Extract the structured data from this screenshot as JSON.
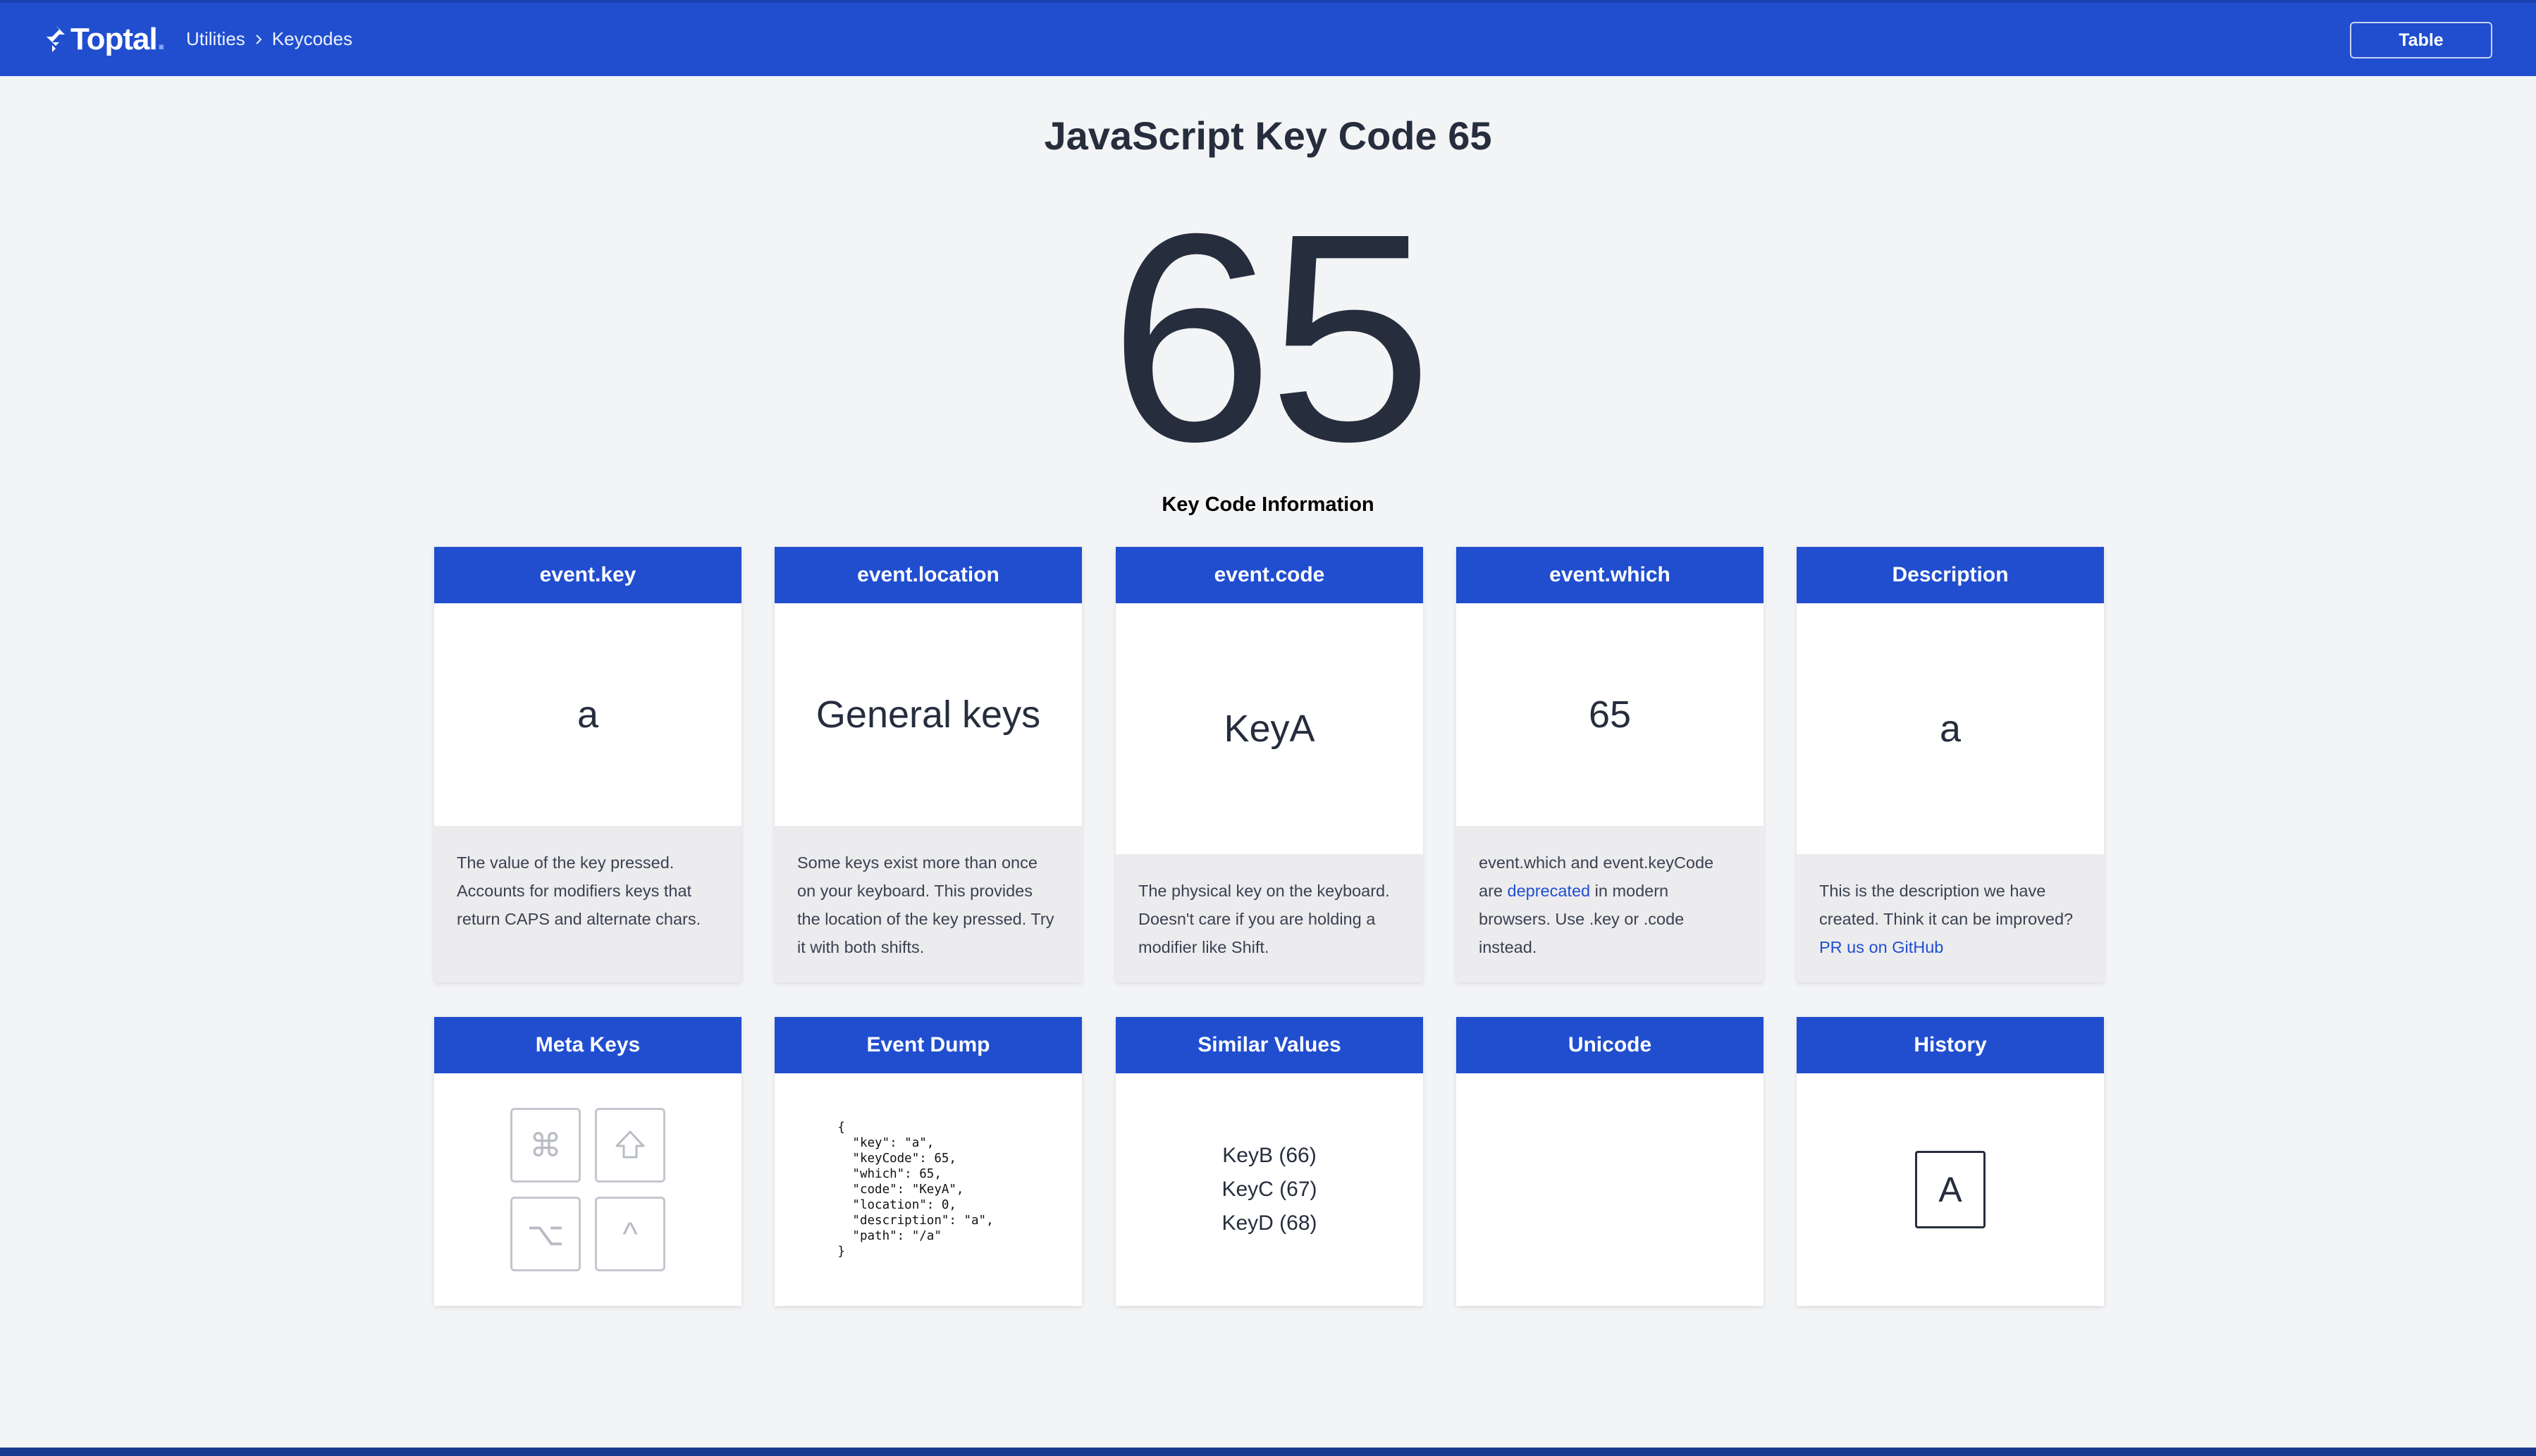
{
  "header": {
    "logo_text": "Toptal",
    "logo_dot": ".",
    "breadcrumb": [
      "Utilities",
      "Keycodes"
    ],
    "table_button": "Table"
  },
  "hero": {
    "title": "JavaScript Key Code 65",
    "code": "65",
    "section_label": "Key Code Information"
  },
  "cards": {
    "event_key": {
      "title": "event.key",
      "value": "a",
      "description": "The value of the key pressed. Accounts for modifiers keys that return CAPS and alternate chars."
    },
    "event_location": {
      "title": "event.location",
      "value": "General keys",
      "description": "Some keys exist more than once on your keyboard. This provides the location of the key pressed. Try it with both shifts."
    },
    "event_code": {
      "title": "event.code",
      "value": "KeyA",
      "description": "The physical key on the keyboard. Doesn't care if you are holding a modifier like Shift."
    },
    "event_which": {
      "title": "event.which",
      "value": "65",
      "description_pre": "event.which and event.keyCode are ",
      "description_link": "deprecated",
      "description_post": " in modern browsers. Use .key or .code instead."
    },
    "description": {
      "title": "Description",
      "value": "a",
      "description_pre": "This is the description we have created. Think it can be improved? ",
      "description_link": "PR us on GitHub"
    },
    "meta_keys": {
      "title": "Meta Keys",
      "keys": [
        {
          "name": "command",
          "glyph": "⌘"
        },
        {
          "name": "shift",
          "glyph": "shift-icon"
        },
        {
          "name": "option",
          "glyph": "⌥"
        },
        {
          "name": "control",
          "glyph": "^"
        }
      ]
    },
    "event_dump": {
      "title": "Event Dump",
      "json": "{\n  \"key\": \"a\",\n  \"keyCode\": 65,\n  \"which\": 65,\n  \"code\": \"KeyA\",\n  \"location\": 0,\n  \"description\": \"a\",\n  \"path\": \"/a\"\n}"
    },
    "similar_values": {
      "title": "Similar Values",
      "items": [
        "KeyB (66)",
        "KeyC (67)",
        "KeyD (68)"
      ]
    },
    "unicode": {
      "title": "Unicode",
      "value": ""
    },
    "history": {
      "title": "History",
      "keys": [
        "A"
      ]
    }
  },
  "colors": {
    "brand_blue": "#204ecf",
    "text_dark": "#262d3d",
    "page_bg": "#f3f4f6",
    "card_foot_bg": "#ececee"
  }
}
